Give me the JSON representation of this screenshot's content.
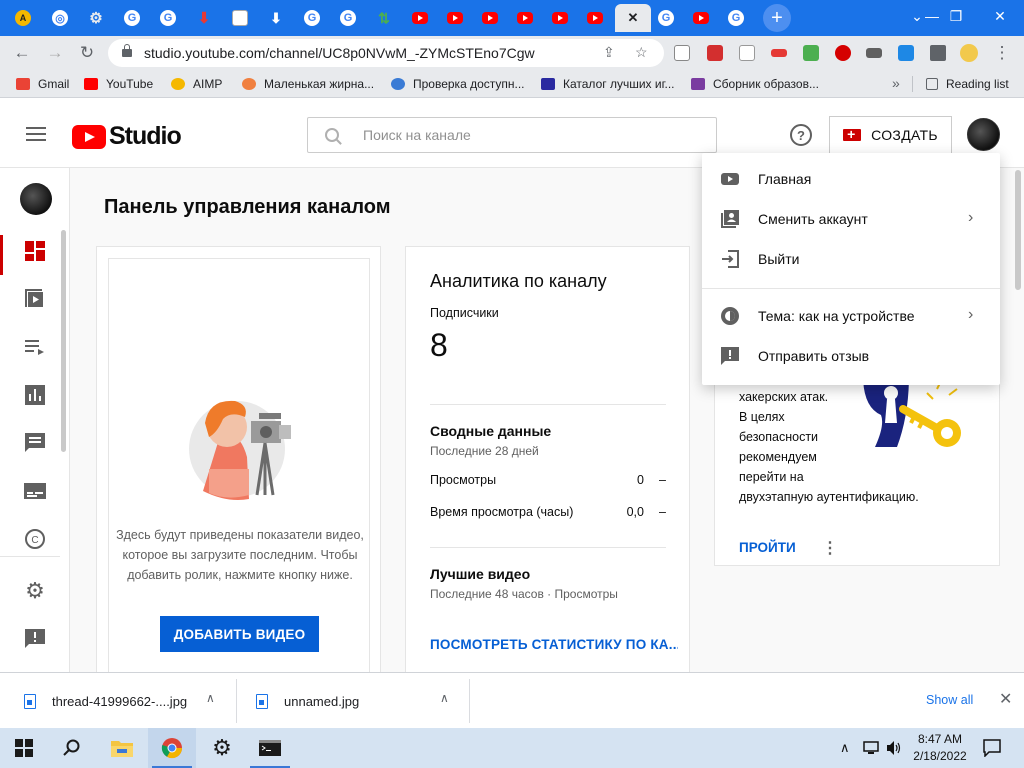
{
  "browser": {
    "url": "studio.youtube.com/channel/UC8p0NVwM_-ZYMcSTEno7Cgw",
    "close_tab_glyph": "✕",
    "new_tab_glyph": "+",
    "tabs": [
      {
        "icon": "aimp-icon"
      },
      {
        "icon": "chrome-icon"
      },
      {
        "icon": "gear-icon"
      },
      {
        "icon": "google-icon"
      },
      {
        "icon": "google-icon"
      },
      {
        "icon": "download-red-icon"
      },
      {
        "icon": "image-icon"
      },
      {
        "icon": "download-icon"
      },
      {
        "icon": "google-icon"
      },
      {
        "icon": "google-icon"
      },
      {
        "icon": "updown-icon"
      },
      {
        "icon": "youtube-icon"
      },
      {
        "icon": "youtube-icon"
      },
      {
        "icon": "youtube-icon"
      },
      {
        "icon": "youtube-icon"
      },
      {
        "icon": "youtube-icon"
      },
      {
        "icon": "youtube-icon"
      },
      {
        "icon": "youtube-active-icon"
      },
      {
        "icon": "google-icon"
      },
      {
        "icon": "youtube-icon"
      },
      {
        "icon": "google-icon"
      }
    ],
    "bookmarks": [
      {
        "label": "Gmail",
        "color": "#ea4335"
      },
      {
        "label": "YouTube",
        "color": "#ff0000"
      },
      {
        "label": "AIMP",
        "color": "#f5b800"
      },
      {
        "label": "Маленькая жирна...",
        "color": "#f08040"
      },
      {
        "label": "Проверка доступн...",
        "color": "#3a7bd5"
      },
      {
        "label": "Каталог лучших иг...",
        "color": "#2a2aa0"
      },
      {
        "label": "Сборник образов...",
        "color": "#7a3ca0"
      }
    ],
    "bookmarks_more": "»",
    "reading_list": "Reading list"
  },
  "studio": {
    "logo_text": "Studio",
    "search_placeholder": "Поиск на канале",
    "help_glyph": "?",
    "create_label": "СОЗДАТЬ",
    "page_title": "Панель управления каналом",
    "upload_card": {
      "text": "Здесь будут приведены показатели видео, которое вы загрузите последним. Чтобы добавить ролик, нажмите кнопку ниже.",
      "button": "ДОБАВИТЬ ВИДЕО"
    },
    "analytics": {
      "title": "Аналитика по каналу",
      "subscribers_label": "Подписчики",
      "subscribers_value": "8",
      "summary_title": "Сводные данные",
      "summary_period": "Последние 28 дней",
      "rows": [
        {
          "label": "Просмотры",
          "value": "0",
          "trend": "–"
        },
        {
          "label": "Время просмотра (часы)",
          "value": "0,0",
          "trend": "–"
        }
      ],
      "top_title": "Лучшие видео",
      "top_period": "Последние 48 часов · Просмотры",
      "link": "ПОСМОТРЕТЬ СТАТИСТИКУ ПО КА..."
    },
    "security_card": {
      "lines": [
        "хакерских атак.",
        "В целях",
        "безопасности",
        "рекомендуем",
        "перейти на",
        "двухэтапную аутентификацию."
      ],
      "link": "ПРОЙТИ",
      "menu_glyph": "⋮"
    },
    "account_menu": {
      "items": [
        {
          "label": "Главная",
          "icon": "youtube-icon",
          "chevron": ""
        },
        {
          "label": "Сменить аккаунт",
          "icon": "switch-account-icon",
          "chevron": "›"
        },
        {
          "label": "Выйти",
          "icon": "sign-out-icon",
          "chevron": ""
        },
        {
          "label": "Тема: как на устройстве",
          "icon": "theme-icon",
          "chevron": "›"
        },
        {
          "label": "Отправить отзыв",
          "icon": "feedback-icon",
          "chevron": ""
        }
      ]
    }
  },
  "downloads": {
    "items": [
      {
        "name": "thread-41999662-....jpg"
      },
      {
        "name": "unnamed.jpg"
      }
    ],
    "caret": "∧",
    "show_all": "Show all",
    "close_glyph": "✕"
  },
  "taskbar": {
    "time": "8:47 AM",
    "date": "2/18/2022",
    "tray_caret": "∧"
  },
  "colors": {
    "accent_blue": "#065fd4",
    "brand_red": "#ff0000",
    "chrome_blue": "#1a73e8"
  }
}
